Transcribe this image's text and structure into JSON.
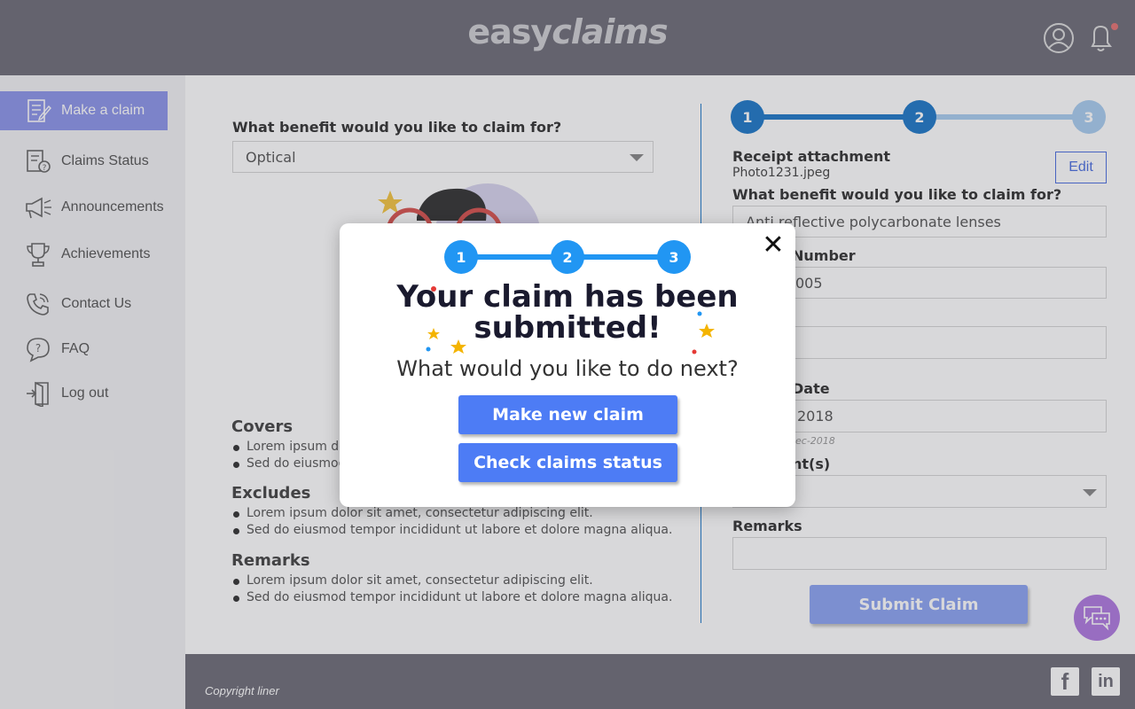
{
  "header": {
    "logo_part1": "easy",
    "logo_part2": "claims",
    "profile_icon": "user-circle-icon",
    "notification_icon": "bell-icon"
  },
  "sidebar": {
    "items": [
      {
        "label": "Make a claim",
        "icon": "form-edit-icon",
        "active": true
      },
      {
        "label": "Claims Status",
        "icon": "document-question-icon",
        "active": false
      },
      {
        "label": "Announcements",
        "icon": "megaphone-icon",
        "active": false
      },
      {
        "label": "Achievements",
        "icon": "trophy-icon",
        "active": false
      },
      {
        "label": "Contact Us",
        "icon": "phone-icon",
        "active": false
      },
      {
        "label": "FAQ",
        "icon": "question-bubble-icon",
        "active": false
      },
      {
        "label": "Log out",
        "icon": "logout-door-icon",
        "active": false
      }
    ]
  },
  "form_left": {
    "benefit_label": "What benefit would you like to claim for?",
    "benefit_value": "Optical",
    "covers_heading": "Covers",
    "covers_items": [
      "Lorem ipsum dolor sit amet, consectetur adipiscing elit.",
      "Sed do eiusmod tempor incididunt ut labore et dolore magna aliqua."
    ],
    "excludes_heading": "Excludes",
    "excludes_items": [
      "Lorem ipsum dolor sit amet, consectetur adipiscing elit.",
      "Sed do eiusmod tempor incididunt ut labore et dolore magna aliqua."
    ],
    "remarks_heading": "Remarks",
    "remarks_items": [
      "Lorem ipsum dolor sit amet, consectetur adipiscing elit.",
      "Sed do eiusmod tempor incididunt ut labore et dolore magna aliqua."
    ]
  },
  "form_right": {
    "steps": [
      "1",
      "2",
      "3"
    ],
    "receipt_label": "Receipt attachment",
    "receipt_file": "Photo1231.jpeg",
    "edit_label": "Edit",
    "benefit_label": "What benefit would you like to claim for?",
    "benefit_value": "Anti reflective polycarbonate lenses",
    "number_label": "Number",
    "number_value": "005",
    "date_label": "Date",
    "date_value": "2018",
    "date_hint": "ec-2018",
    "attachments_label": "nt(s)",
    "remarks_label": "Remarks",
    "remarks_value": "",
    "submit_label": "Submit Claim",
    "chat_icon": "chat-bubbles-icon"
  },
  "footer": {
    "copyright": "Copyright liner",
    "facebook": "f",
    "linkedin": "in"
  },
  "modal": {
    "steps": [
      "1",
      "2",
      "3"
    ],
    "title_line1": "Your claim has been",
    "title_line2": "submitted!",
    "subtitle": "What would you like to do next?",
    "primary_button": "Make new claim",
    "secondary_button": "Check claims status",
    "close_icon": "close-icon"
  },
  "colors": {
    "header_bg": "#6e6d78",
    "accent": "#4d7cf5",
    "step_blue": "#2196f3",
    "sidebar_active": "#8d95ea"
  }
}
